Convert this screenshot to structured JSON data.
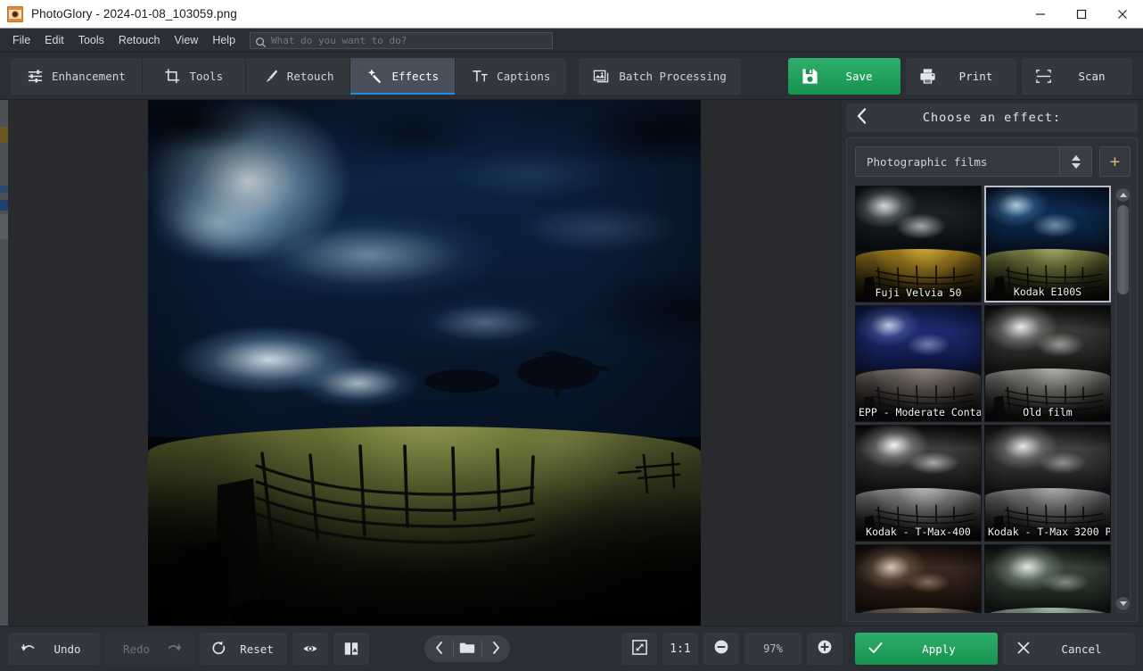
{
  "window": {
    "title": "PhotoGlory - 2024-01-08_103059.png",
    "app_icon": "camera-film-icon",
    "controls": {
      "minimize": "minimize-icon",
      "maximize": "maximize-icon",
      "close": "close-icon"
    }
  },
  "menubar": {
    "items": [
      "File",
      "Edit",
      "Tools",
      "Retouch",
      "View",
      "Help"
    ],
    "search": {
      "icon": "search-icon",
      "placeholder": "What do you want to do?",
      "value": ""
    }
  },
  "toolbar": {
    "tabs": [
      {
        "label": "Enhancement",
        "icon": "sliders-icon",
        "active": false
      },
      {
        "label": "Tools",
        "icon": "crop-icon",
        "active": false
      },
      {
        "label": "Retouch",
        "icon": "brush-icon",
        "active": false
      },
      {
        "label": "Effects",
        "icon": "wand-icon",
        "active": true
      },
      {
        "label": "Captions",
        "icon": "text-icon",
        "active": false
      }
    ],
    "batch": {
      "label": "Batch Processing",
      "icon": "images-icon"
    },
    "actions": [
      {
        "label": "Save",
        "icon": "floppy-disk-icon",
        "primary": true
      },
      {
        "label": "Print",
        "icon": "printer-icon",
        "primary": false
      },
      {
        "label": "Scan",
        "icon": "scan-icon",
        "primary": false
      }
    ]
  },
  "right_panel": {
    "back_icon": "chevron-left-icon",
    "title": "Choose an effect:",
    "category": {
      "value": "Photographic films",
      "spinner_icon": "spinner-updown-icon"
    },
    "add_button": {
      "label": "+",
      "icon": "plus-icon"
    },
    "effects": [
      {
        "name": "Fuji Velvia 50",
        "selected": false,
        "style": "warm"
      },
      {
        "name": "Kodak E100S",
        "selected": true,
        "style": "cool"
      },
      {
        "name": "EPP - Moderate Conta⋯",
        "selected": false,
        "style": "violet"
      },
      {
        "name": "Old film",
        "selected": false,
        "style": "mono"
      },
      {
        "name": "Kodak - T-Max-400",
        "selected": false,
        "style": "mono2"
      },
      {
        "name": "Kodak - T-Max 3200 P⋯",
        "selected": false,
        "style": "mono3"
      },
      {
        "name": "",
        "selected": false,
        "style": "sepia"
      },
      {
        "name": "",
        "selected": false,
        "style": "greenmono"
      }
    ],
    "scrollbar": {
      "up_icon": "scroll-up-icon",
      "down_icon": "scroll-down-icon"
    }
  },
  "bottom_bar": {
    "undo": {
      "label": "Undo",
      "icon": "undo-arrow-icon",
      "disabled": false
    },
    "redo": {
      "label": "Redo",
      "icon": "redo-arrow-icon",
      "disabled": true
    },
    "reset": {
      "label": "Reset",
      "icon": "reset-circle-icon"
    },
    "preview": {
      "icon": "eye-icon"
    },
    "before_after": {
      "icon": "compare-icon"
    },
    "nav": {
      "prev_icon": "chevron-left-icon",
      "folder_icon": "folder-icon",
      "next_icon": "chevron-right-icon"
    },
    "fit": {
      "icon": "fit-to-screen-icon"
    },
    "one_to_one": {
      "label": "1:1"
    },
    "zoom_out": {
      "icon": "minus-circle-icon"
    },
    "zoom_level": {
      "value": "97%"
    },
    "zoom_in": {
      "icon": "plus-circle-icon"
    },
    "apply": {
      "label": "Apply",
      "icon": "checkmark-icon"
    },
    "cancel": {
      "label": "Cancel",
      "icon": "x-mark-icon"
    }
  },
  "colors": {
    "accent_blue": "#1e90e8",
    "primary_green": "#16934f",
    "panel_bg": "#2b2e34",
    "canvas_bg": "#282a2e",
    "text": "#dfe2e7"
  }
}
